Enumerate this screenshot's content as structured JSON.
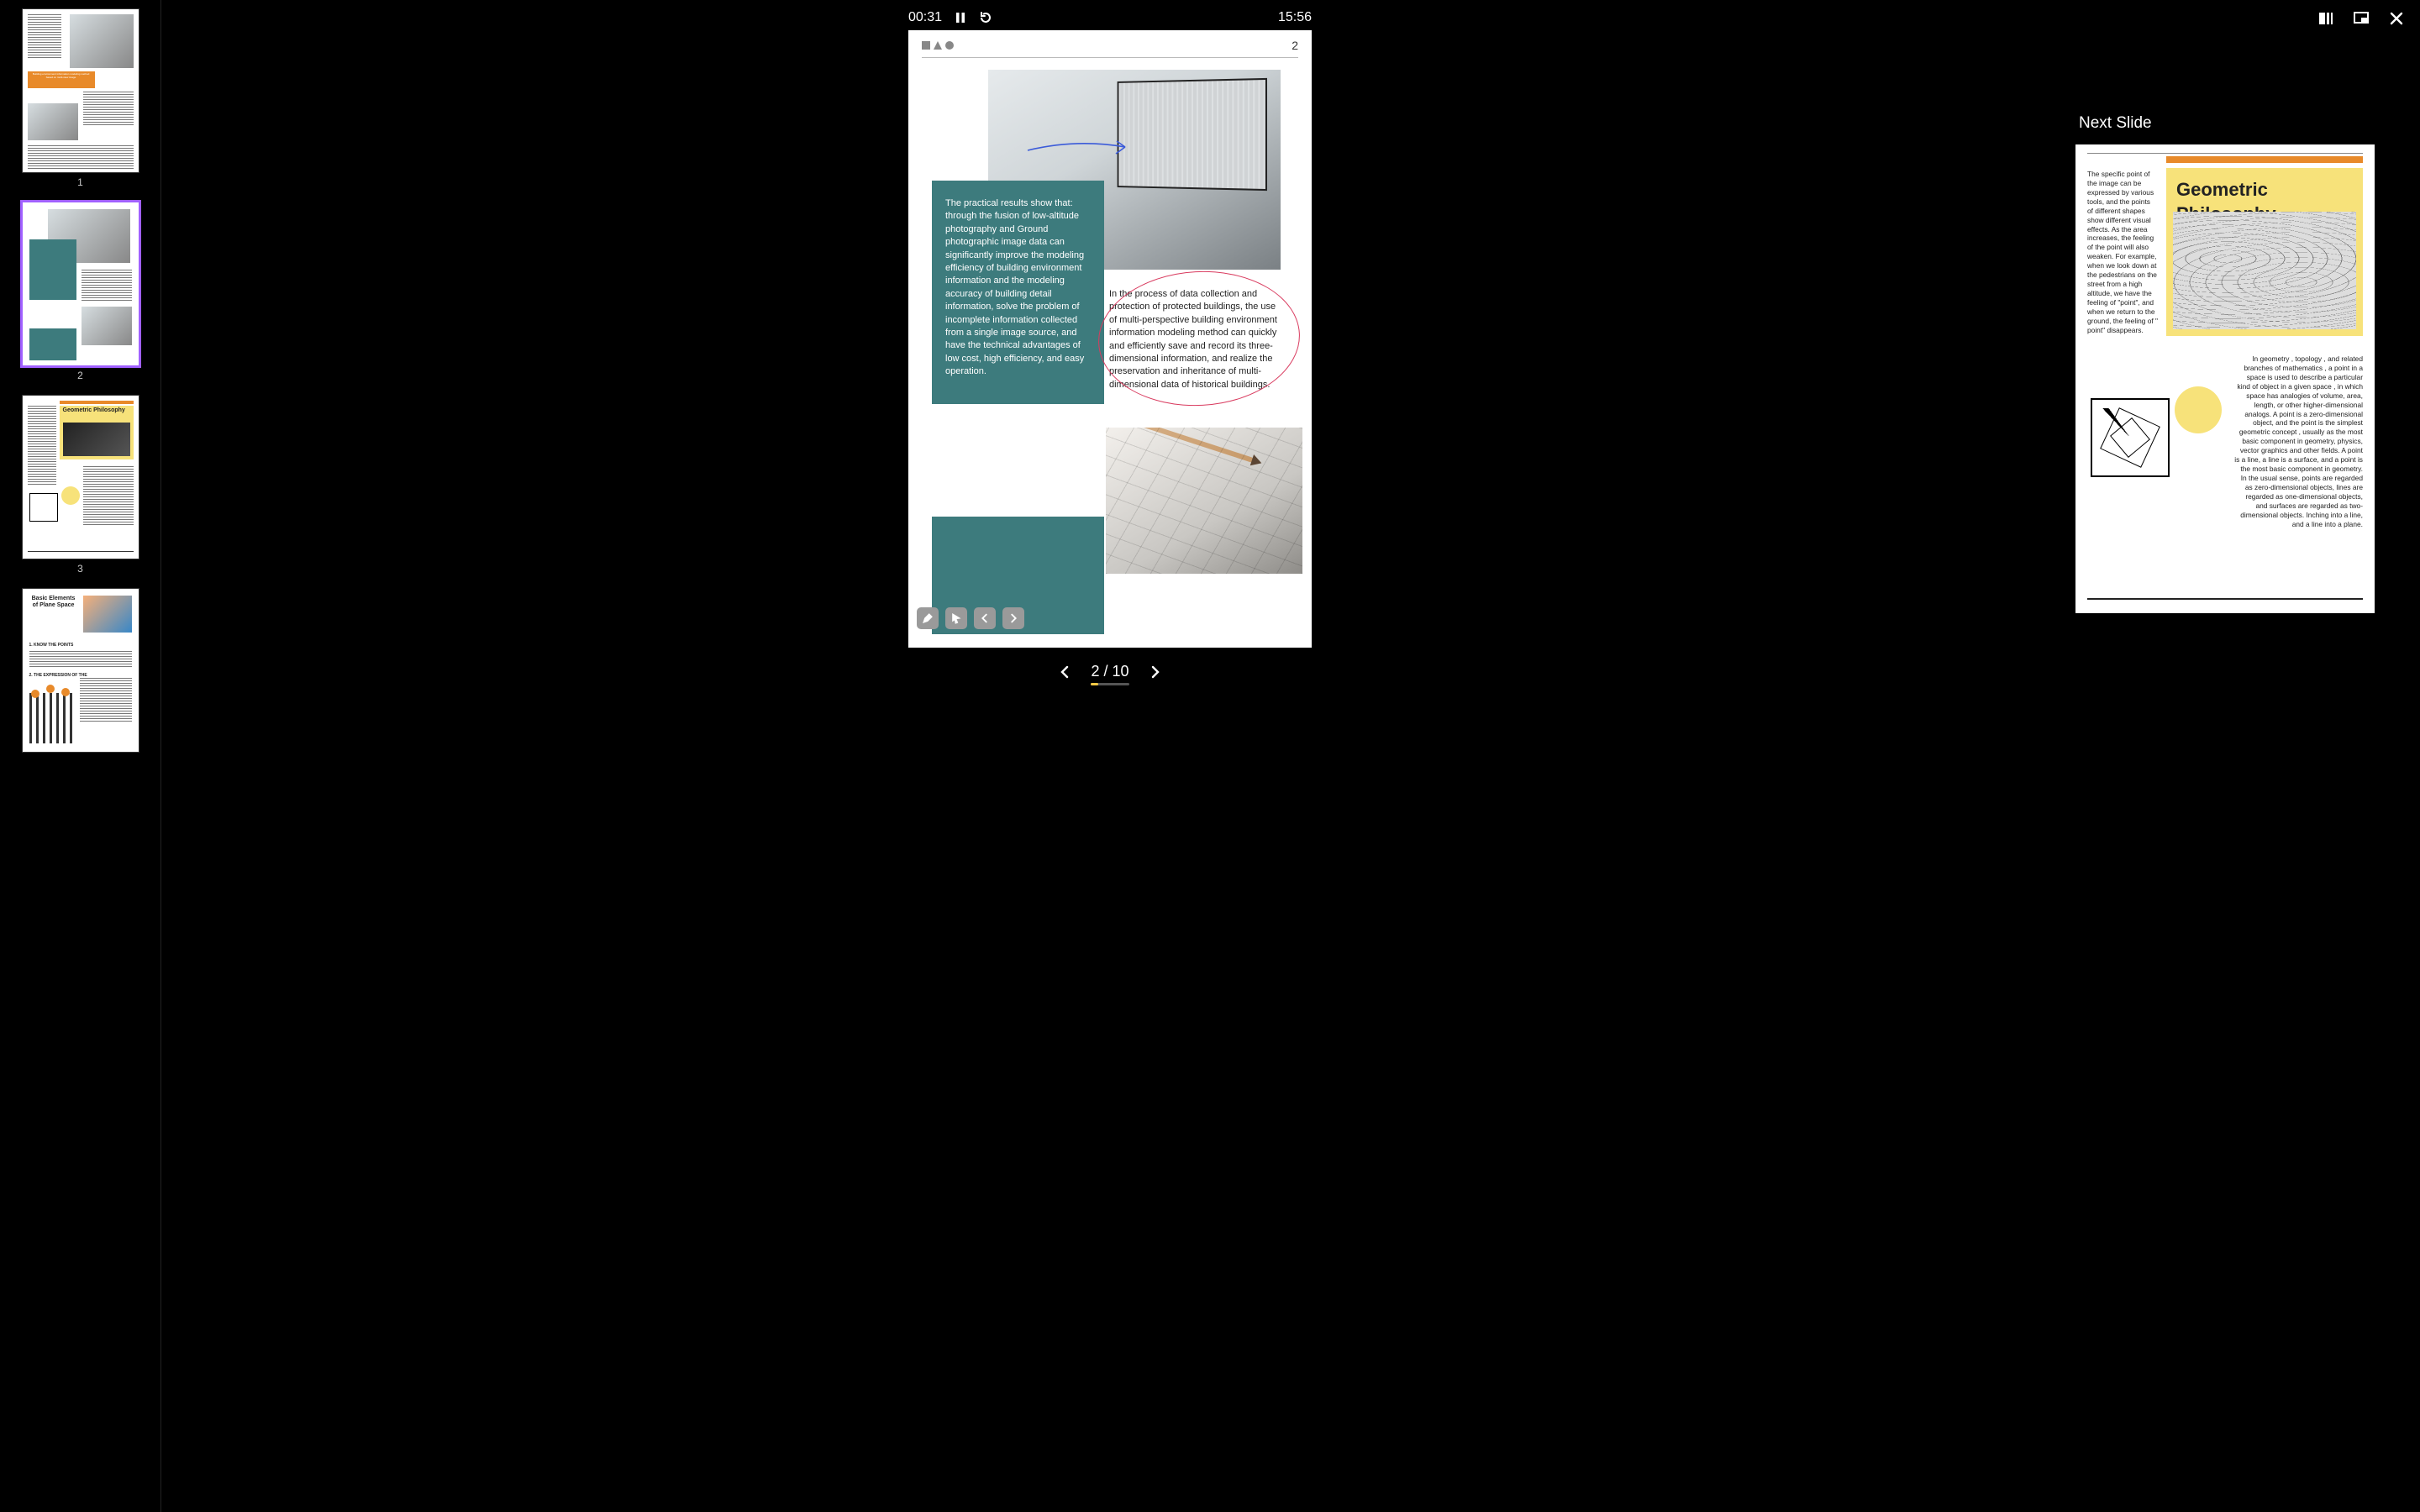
{
  "player": {
    "elapsed": "00:31",
    "total": "15:56",
    "page_current": 2,
    "page_total": 10,
    "page_display": "2 / 10"
  },
  "thumbnails": {
    "labels": [
      "1",
      "2",
      "3",
      "4"
    ],
    "active_index": 1,
    "t1_band": "Building environment information modeling method based on multi-view image",
    "t3_title": "Geometric Philosophy",
    "t4_title": "Basic Elements of Plane Space",
    "t4_sec1": "1. KNOW THE POINTS",
    "t4_sec2": "2. THE EXPRESSION OF THE"
  },
  "slide": {
    "page_number": "2",
    "teal_text": "The practical results show that: through the fusion of low-altitude photography and Ground photographic image data can significantly improve the modeling efficiency of building environment information and the modeling accuracy of building detail information, solve the problem of incomplete information collected from a single image source, and have the technical advantages of low cost, high efficiency, and easy operation.",
    "circled_text": "In the process of data collection and protection of protected buildings, the use of multi-perspective building environment information modeling method can quickly and efficiently save and record its three-dimensional information, and realize the preservation and inheritance of multi-dimensional data of historical buildings.",
    "tools": {
      "pen": "pen-tool",
      "pointer": "pointer-tool",
      "prev_anno": "prev-annotation",
      "next_anno": "next-annotation"
    }
  },
  "next": {
    "label": "Next Slide",
    "title": "Geometric Philosophy",
    "left_text": "The specific point of the image can be expressed by various tools, and the points of different shapes show different visual effects. As the area increases, the feeling of the point will also weaken. For example, when we look down at the pedestrians on the street from a high altitude, we have the feeling of \"point\", and when we return to the ground, the feeling of \" point\" disappears.",
    "right_text": "In geometry , topology , and related branches  of mathematics , a point in a space is used to describe a particular kind of object in a given space , in which space has analogies of volume, area, length, or other higher-dimensional analogs. A point is a zero-dimensional object, and the point is the simplest geometric  concept , usually  as the most basic component in geometry, physics, vector graphics and other fields. A point is a line, a line is a surface, and a point is the most basic component in geometry. In the usual sense, points are regarded as zero-dimensional objects, lines are regarded as one-dimensional objects, and surfaces are regarded as two-dimensional objects. Inching into a line, and a line into a plane."
  },
  "topbar": {
    "grid": "grid-view",
    "pip": "picture-in-picture",
    "close": "close"
  }
}
